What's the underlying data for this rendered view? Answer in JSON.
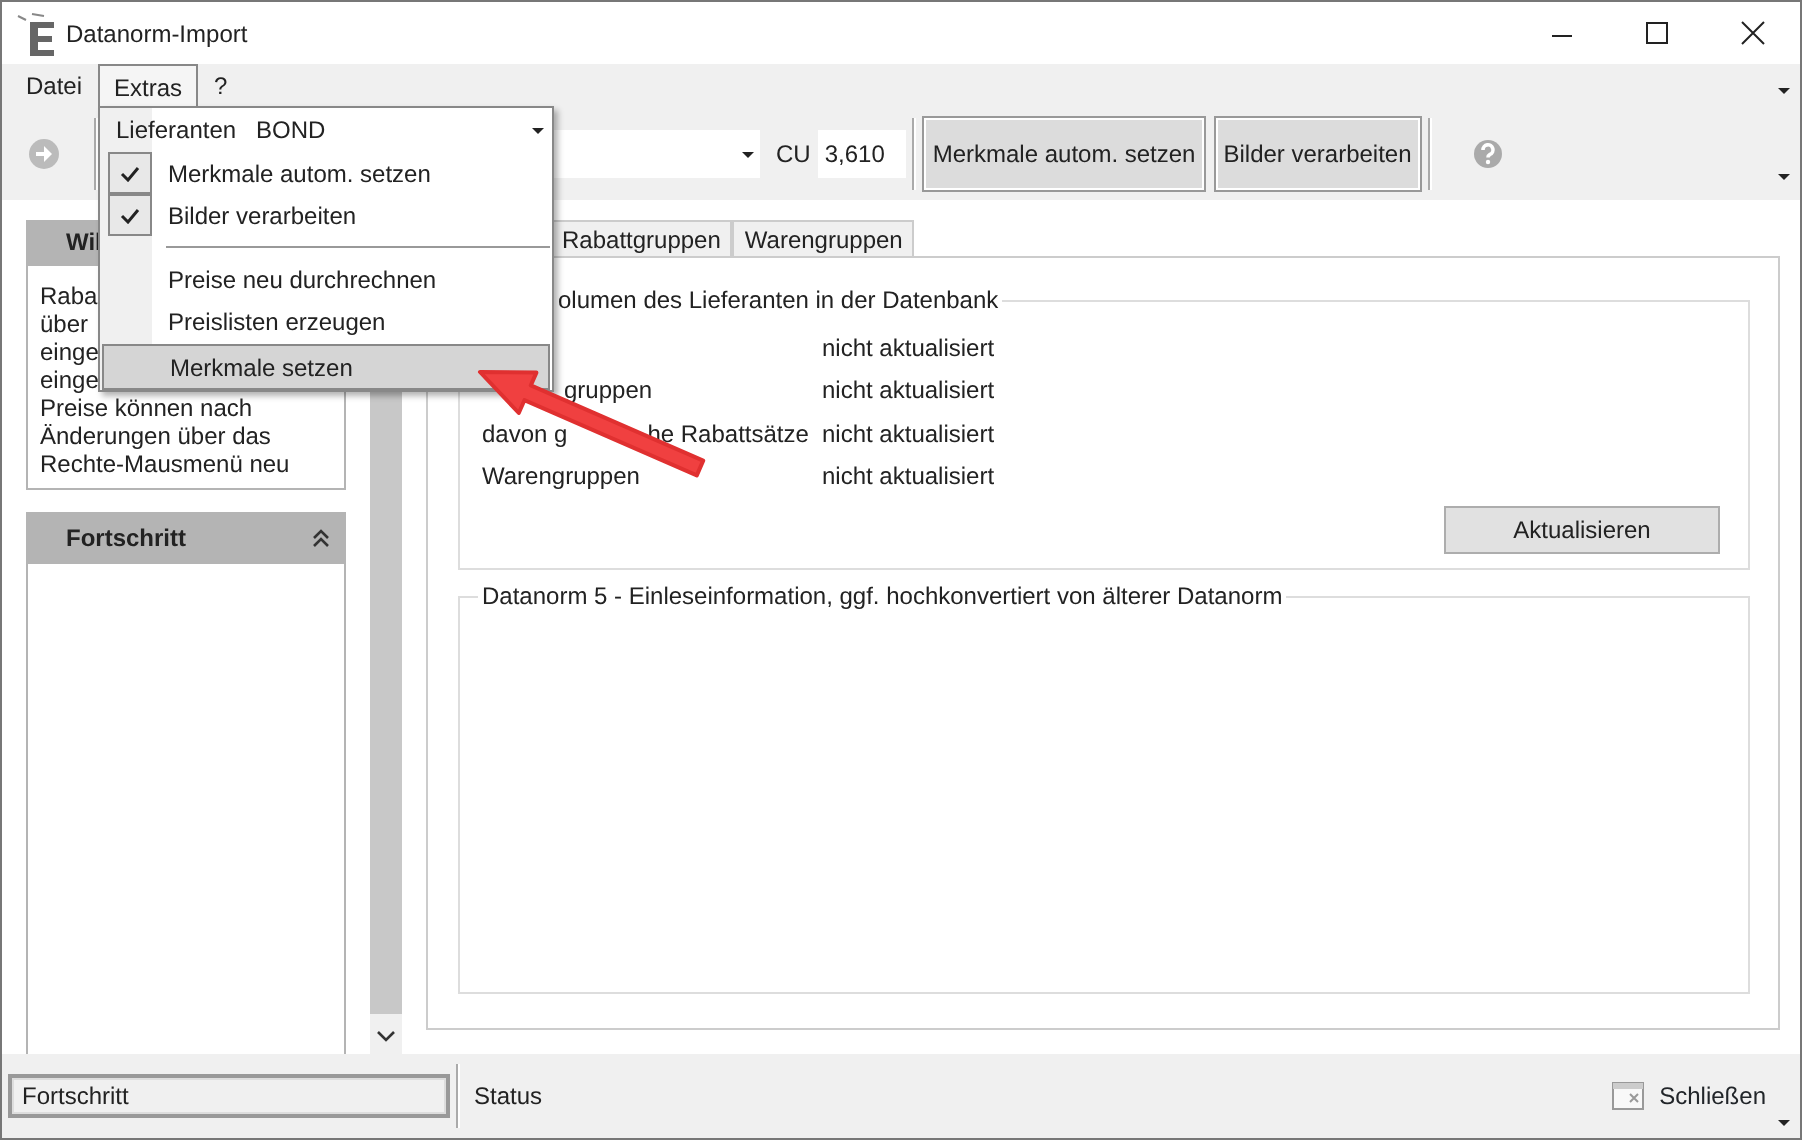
{
  "window": {
    "title": "Datanorm-Import"
  },
  "menu_bar": [
    {
      "label": "Datei",
      "selected": false
    },
    {
      "label": "Extras",
      "selected": true
    },
    {
      "label": "?",
      "selected": false
    }
  ],
  "extras_menu": {
    "supplier_label": "Lieferanten",
    "supplier_value": "BOND",
    "items": [
      {
        "kind": "check",
        "label": "Merkmale autom. setzen",
        "checked": true,
        "selected": false
      },
      {
        "kind": "check",
        "label": "Bilder verarbeiten",
        "checked": true,
        "selected": false
      },
      {
        "kind": "separator"
      },
      {
        "kind": "command",
        "label": "Preise neu durchrechnen",
        "selected": false
      },
      {
        "kind": "command",
        "label": "Preislisten erzeugen",
        "selected": false
      },
      {
        "kind": "command",
        "label": "Merkmale setzen",
        "selected": true
      }
    ]
  },
  "toolbar": {
    "cu_label": "CU",
    "cu_value": "3,610",
    "buttons": [
      "Merkmale autom. setzen",
      "Bilder verarbeiten"
    ]
  },
  "left_panel": {
    "info_title": "Wil",
    "info_lines": [
      "Raba",
      "über",
      "einge",
      "einge",
      "Preise können nach",
      "Änderungen über das",
      "Rechte-Mausmenü neu"
    ],
    "progress_title": "Fortschritt"
  },
  "tabs": [
    {
      "label": "Rabattgruppen",
      "selected": false
    },
    {
      "label": "Warengruppen",
      "selected": false
    }
  ],
  "volume_group": {
    "title": "olumen des Lieferanten in der Datenbank",
    "rows": [
      {
        "value": "nicht aktualisiert"
      },
      {
        "label": [
          "gruppen"
        ],
        "cut_left": true,
        "value": "nicht aktualisiert"
      },
      {
        "label": [
          "davon g",
          "he Rabattsätze"
        ],
        "cut_left": false,
        "value": "nicht aktualisiert"
      },
      {
        "label": [
          "Warengruppen"
        ],
        "cut_left": false,
        "value": "nicht aktualisiert"
      }
    ],
    "button": "Aktualisieren"
  },
  "info_group": {
    "title": "Datanorm 5 - Einleseinformation, ggf. hochkonvertiert von älterer Datanorm"
  },
  "status_bar": {
    "progress": "Fortschritt",
    "status": "Status",
    "close": "Schließen"
  }
}
